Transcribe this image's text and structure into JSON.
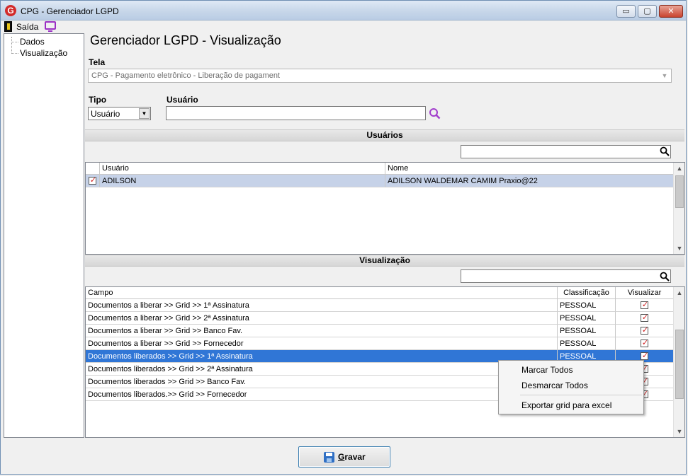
{
  "window": {
    "title": "CPG - Gerenciador LGPD",
    "controls": {
      "minimize": "▭",
      "maximize": "▢",
      "close": "✕"
    }
  },
  "menu": {
    "exit_label": "Saída"
  },
  "tree": {
    "items": [
      "Dados",
      "Visualização"
    ]
  },
  "page_title": "Gerenciador LGPD - Visualização",
  "tela": {
    "label": "Tela",
    "value": "CPG - Pagamento eletrônico - Liberação de pagament"
  },
  "tipo": {
    "label": "Tipo",
    "value": "Usuário"
  },
  "usuario_field": {
    "label": "Usuário",
    "value": ""
  },
  "usuarios_section": {
    "header": "Usuários",
    "search_value": "",
    "columns": [
      "Usuário",
      "Nome"
    ],
    "rows": [
      {
        "checked": true,
        "usuario": "ADILSON",
        "nome": "ADILSON WALDEMAR CAMIM Praxio@22"
      }
    ]
  },
  "visualizacao_section": {
    "header": "Visualização",
    "search_value": "",
    "columns": [
      "Campo",
      "Classificação",
      "Visualizar"
    ],
    "rows": [
      {
        "campo": "Documentos a liberar >> Grid >> 1ª Assinatura",
        "classificacao": "PESSOAL",
        "visualizar": true
      },
      {
        "campo": "Documentos a liberar >> Grid >> 2ª Assinatura",
        "classificacao": "PESSOAL",
        "visualizar": true
      },
      {
        "campo": "Documentos a liberar >> Grid >> Banco Fav.",
        "classificacao": "PESSOAL",
        "visualizar": true
      },
      {
        "campo": "Documentos a liberar >> Grid >> Fornecedor",
        "classificacao": "PESSOAL",
        "visualizar": true
      },
      {
        "campo": "Documentos liberados >> Grid >> 1ª Assinatura",
        "classificacao": "PESSOAL",
        "visualizar": true
      },
      {
        "campo": "Documentos liberados >> Grid >> 2ª Assinatura",
        "classificacao": "",
        "visualizar": true
      },
      {
        "campo": "Documentos liberados >> Grid >> Banco Fav.",
        "classificacao": "",
        "visualizar": true
      },
      {
        "campo": "Documentos liberados.>> Grid >> Fornecedor",
        "classificacao": "",
        "visualizar": true
      }
    ]
  },
  "context_menu": {
    "items": [
      "Marcar Todos",
      "Desmarcar Todos",
      "Exportar grid para excel"
    ]
  },
  "save_button": {
    "label_prefix": "",
    "label_underlined": "G",
    "label_rest": "ravar"
  },
  "colors": {
    "selection_blue": "#3076d6",
    "selection_gray": "#c6d2e8",
    "check_red": "#d01c1c",
    "accent_purple": "#9b2fc4"
  }
}
